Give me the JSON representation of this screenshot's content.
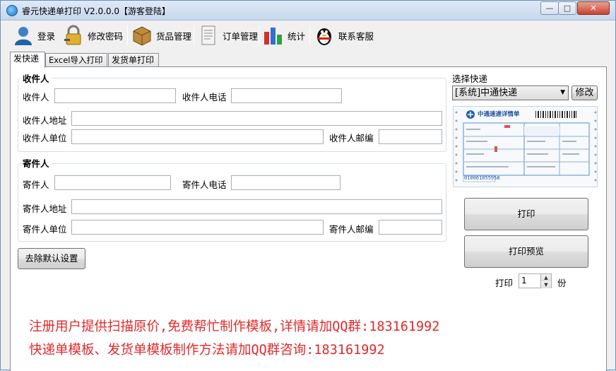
{
  "window": {
    "title": "睿元快递单打印 V2.0.0.0【游客登陆】",
    "min_label": "—",
    "max_label": "□",
    "close_label": "✕"
  },
  "toolbar": {
    "items": [
      {
        "label": "登录",
        "icon": "user-icon"
      },
      {
        "label": "修改密码",
        "icon": "lock-icon"
      },
      {
        "label": "货品管理",
        "icon": "box-icon"
      },
      {
        "label": "订单管理",
        "icon": "document-icon"
      },
      {
        "label": "统计",
        "icon": "bar-chart-icon"
      },
      {
        "label": "联系客服",
        "icon": "qq-penguin-icon"
      }
    ]
  },
  "tabs": [
    {
      "label": "发快递",
      "active": true
    },
    {
      "label": "Excel导入打印",
      "active": false
    },
    {
      "label": "发货单打印",
      "active": false
    }
  ],
  "receiver": {
    "section_title": "收件人",
    "name_label": "收件人",
    "name_value": "",
    "phone_label": "收件人电话",
    "phone_value": "",
    "address_label": "收件人地址",
    "address_value": "",
    "company_label": "收件人单位",
    "company_value": "",
    "zip_label": "收件人邮编",
    "zip_value": ""
  },
  "sender": {
    "section_title": "寄件人",
    "name_label": "寄件人",
    "name_value": "",
    "phone_label": "寄件人电话",
    "phone_value": "",
    "address_label": "寄件人地址",
    "address_value": "",
    "company_label": "寄件人单位",
    "company_value": "",
    "zip_label": "寄件人邮编",
    "zip_value": ""
  },
  "actions": {
    "clear_defaults_label": "去除默认设置"
  },
  "express": {
    "select_label": "选择快递",
    "selected": "[系统]中通快递",
    "modify_label": "修改",
    "waybill": {
      "brand": "中通速递详情单",
      "number": "010061055958"
    }
  },
  "print": {
    "print_label": "打印",
    "preview_label": "打印预览",
    "copies_prefix": "打印",
    "copies_value": "1",
    "copies_suffix": "份"
  },
  "notices": [
    "注册用户提供扫描原价,免费帮忙制作模板,详情请加QQ群:183161992",
    "快递单模板、发货单模板制作方法请加QQ群咨询:183161992"
  ],
  "colors": {
    "notice": "#e0292b",
    "accent": "#1a6fc4"
  }
}
